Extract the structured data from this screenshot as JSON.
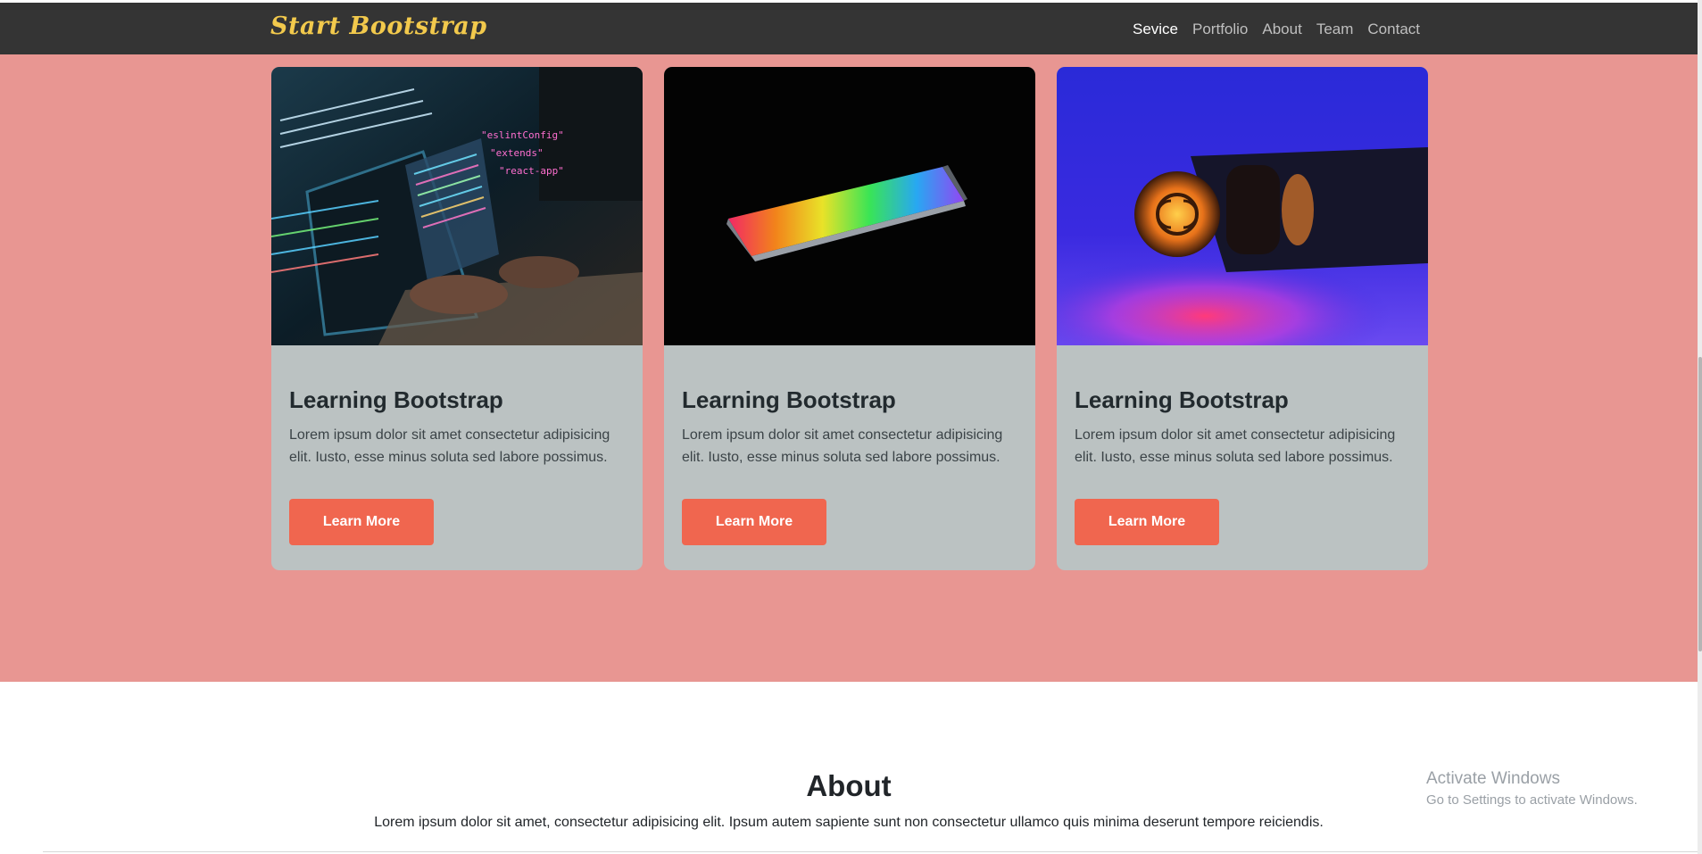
{
  "navbar": {
    "brand": "Start Bootstrap",
    "links": [
      "Sevice",
      "Portfolio",
      "About",
      "Team",
      "Contact"
    ]
  },
  "services": {
    "cards": [
      {
        "title": "Learning Bootstrap",
        "text": "Lorem ipsum dolor sit amet consectetur adipisicing elit. Iusto, esse minus soluta sed labore possimus.",
        "button": "Learn More",
        "image": "coding-laptop-image"
      },
      {
        "title": "Learning Bootstrap",
        "text": "Lorem ipsum dolor sit amet consectetur adipisicing elit. Iusto, esse minus soluta sed labore possimus.",
        "button": "Learn More",
        "image": "rainbow-laptop-image"
      },
      {
        "title": "Learning Bootstrap",
        "text": "Lorem ipsum dolor sit amet consectetur adipisicing elit. Iusto, esse minus soluta sed labore possimus.",
        "button": "Learn More",
        "image": "perfume-bottle-image"
      }
    ]
  },
  "about": {
    "title": "About",
    "text": "Lorem ipsum dolor sit amet, consectetur adipisicing elit. Ipsum autem sapiente sunt non consectetur ullamco quis minima deserunt tempore reiciendis."
  },
  "watermark": {
    "line1": "Activate Windows",
    "line2": "Go to Settings to activate Windows."
  },
  "colors": {
    "navbar": "#343434",
    "brand": "#f2c94c",
    "section_bg": "#e89692",
    "card_bg": "#bbc2c2",
    "button": "#f0664f"
  }
}
